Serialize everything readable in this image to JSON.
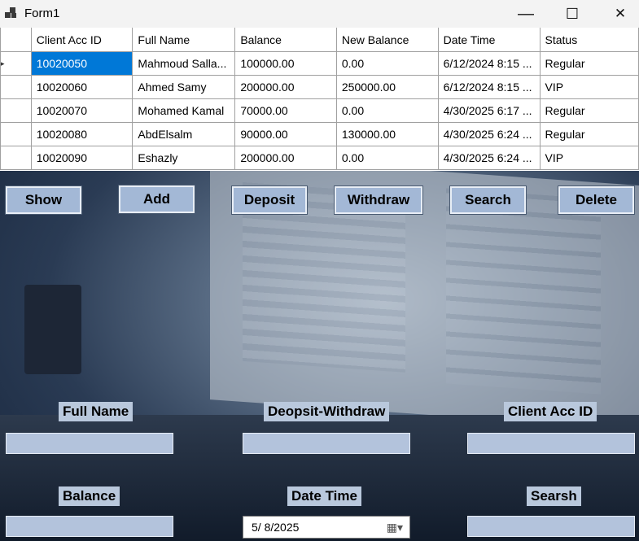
{
  "window": {
    "title": "Form1",
    "minimize_glyph": "—",
    "maximize_glyph": "☐",
    "close_glyph": "✕"
  },
  "grid": {
    "columns": [
      "Client Acc ID",
      "Full Name",
      "Balance",
      "New Balance",
      "Date Time",
      "Status"
    ],
    "rows": [
      [
        "10020050",
        "Mahmoud Salla...",
        "100000.00",
        "0.00",
        "6/12/2024 8:15 ...",
        "Regular"
      ],
      [
        "10020060",
        "Ahmed Samy",
        "200000.00",
        "250000.00",
        "6/12/2024 8:15 ...",
        "VIP"
      ],
      [
        "10020070",
        "Mohamed Kamal",
        "70000.00",
        "0.00",
        "4/30/2025 6:17 ...",
        "Regular"
      ],
      [
        "10020080",
        "AbdElsalm",
        "90000.00",
        "130000.00",
        "4/30/2025 6:24 ...",
        "Regular"
      ],
      [
        "10020090",
        "Eshazly",
        "200000.00",
        "0.00",
        "4/30/2025 6:24 ...",
        "VIP"
      ]
    ],
    "current_row_marker": "▸"
  },
  "buttons": {
    "show": "Show",
    "add": "Add",
    "deposit": "Deposit",
    "withdraw": "Withdraw",
    "search": "Search",
    "delete": "Delete"
  },
  "labels": {
    "full_name": "Full Name",
    "deposit_withdraw": "Deopsit-Withdraw",
    "client_acc_id": "Client Acc ID",
    "balance": "Balance",
    "date_time": "Date Time",
    "search": "Searsh"
  },
  "inputs": {
    "full_name": "",
    "deposit_withdraw": "",
    "client_acc_id": "",
    "balance": "",
    "search": ""
  },
  "date_picker": {
    "value": "5/  8/2025",
    "icon": "calendar-icon"
  },
  "colors": {
    "selection": "#0078d7",
    "button_bg": "#a3b8d6",
    "field_bg": "#b3c3dc"
  }
}
